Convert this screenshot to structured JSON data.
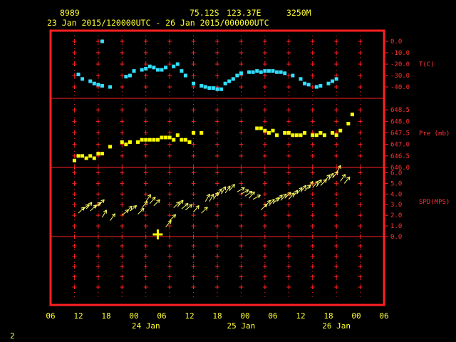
{
  "header": {
    "station_id": "8989",
    "latitude": "75.12S",
    "longitude": "123.37E",
    "elevation": "3250M",
    "time_range": "23 Jan 2015/120000UTC - 26 Jan 2015/000000UTC"
  },
  "footer_label": "2",
  "colors": {
    "frame": "#ff2020",
    "text": "#ffff33",
    "temp": "#33e0ff",
    "pres": "#ffff00",
    "wind": "#ffff66"
  },
  "x_axis": {
    "hour_labels": [
      "06",
      "12",
      "18",
      "00",
      "06",
      "12",
      "18",
      "00",
      "06",
      "12",
      "18",
      "00",
      "06"
    ],
    "date_labels": [
      "24 Jan",
      "25 Jan",
      "26 Jan"
    ],
    "date_label_hours": [
      30,
      54,
      78
    ]
  },
  "chart_data": [
    {
      "type": "scatter",
      "ylabel": "T(C)",
      "ylim": [
        -50,
        5
      ],
      "tick_labels": [
        "0.0",
        "-10.0",
        "-20.0",
        "-30.0",
        "-40.0"
      ],
      "x_hours": [
        13,
        14,
        16,
        17,
        18,
        19,
        21,
        25,
        26,
        27,
        29,
        30,
        31,
        32,
        33,
        34,
        35,
        37,
        38,
        39,
        40,
        42,
        44,
        45,
        46,
        47,
        48,
        49,
        50,
        51,
        52,
        53,
        54,
        56,
        57,
        58,
        59,
        60,
        61,
        62,
        63,
        64,
        65,
        67,
        69,
        70,
        71,
        73,
        74,
        76,
        77,
        78,
        19
      ],
      "values": [
        -29,
        -33,
        -35,
        -37,
        -38,
        -39,
        -40,
        -31,
        -30,
        -26,
        -25,
        -24,
        -22,
        -23,
        -25,
        -25,
        -23,
        -22,
        -20,
        -26,
        -30,
        -37,
        -39,
        -40,
        -41,
        -41,
        -42,
        -42,
        -37,
        -35,
        -33,
        -30,
        -28,
        -27,
        -27,
        -26,
        -27,
        -26,
        -26,
        -26,
        -27,
        -27,
        -28,
        -30,
        -33,
        -37,
        -38,
        -40,
        -39,
        -37,
        -35,
        -33,
        0
      ]
    },
    {
      "type": "scatter",
      "ylabel": "Pre (mb)",
      "ylim": [
        646,
        649
      ],
      "tick_labels": [
        "648.5",
        "648.0",
        "647.5",
        "647.0",
        "646.5",
        "646.0"
      ],
      "x_hours": [
        12,
        13,
        14,
        15,
        16,
        17,
        18,
        19,
        21,
        24,
        25,
        26,
        28,
        29,
        30,
        31,
        32,
        33,
        34,
        35,
        36,
        37,
        38,
        39,
        40,
        41,
        42,
        44,
        58,
        59,
        60,
        61,
        62,
        63,
        65,
        66,
        67,
        68,
        69,
        70,
        72,
        73,
        74,
        75,
        77,
        78,
        79,
        81,
        82
      ],
      "values": [
        646.3,
        646.5,
        646.5,
        646.4,
        646.5,
        646.4,
        646.6,
        646.6,
        646.9,
        647.1,
        647.0,
        647.1,
        647.1,
        647.2,
        647.2,
        647.2,
        647.2,
        647.2,
        647.3,
        647.3,
        647.3,
        647.2,
        647.4,
        647.2,
        647.2,
        647.1,
        647.5,
        647.5,
        647.7,
        647.7,
        647.6,
        647.5,
        647.6,
        647.4,
        647.5,
        647.5,
        647.4,
        647.4,
        647.4,
        647.5,
        647.4,
        647.4,
        647.5,
        647.4,
        647.5,
        647.4,
        647.6,
        647.9,
        648.3
      ]
    },
    {
      "type": "scatter",
      "ylabel": "SPD(MPS)",
      "ylim": [
        0,
        6.5
      ],
      "tick_labels": [
        "6.0",
        "5.0",
        "4.0",
        "3.0",
        "2.0",
        "1.0",
        "0.0"
      ],
      "x_hours": [
        13,
        14,
        15,
        16,
        17,
        18,
        19,
        21,
        24,
        25,
        26,
        28,
        29,
        30,
        31,
        32,
        33,
        35,
        36,
        37,
        38,
        39,
        40,
        42,
        44,
        45,
        46,
        47,
        48,
        49,
        50,
        51,
        53,
        54,
        55,
        56,
        57,
        59,
        60,
        61,
        62,
        63,
        64,
        65,
        66,
        67,
        68,
        69,
        70,
        71,
        72,
        73,
        74,
        75,
        76,
        77,
        78,
        79,
        80
      ],
      "values": [
        2.2,
        2.5,
        2.6,
        2.4,
        2.7,
        2.9,
        1.8,
        1.5,
        2.0,
        2.3,
        2.4,
        2.1,
        2.7,
        3.3,
        3.1,
        2.9,
        0.2,
        0.9,
        1.5,
        2.7,
        2.8,
        2.6,
        2.5,
        2.3,
        2.2,
        3.3,
        3.3,
        3.5,
        3.8,
        4.0,
        4.1,
        4.3,
        4.2,
        4.0,
        3.8,
        3.6,
        3.5,
        2.5,
        2.8,
        2.9,
        3.1,
        3.3,
        3.4,
        3.6,
        3.5,
        3.7,
        4.0,
        4.2,
        4.3,
        4.5,
        4.6,
        4.7,
        4.8,
        5.2,
        5.3,
        5.5,
        6.0,
        5.2,
        5.0
      ],
      "directions_deg": [
        45,
        50,
        40,
        45,
        50,
        45,
        30,
        35,
        50,
        45,
        50,
        45,
        40,
        35,
        40,
        45,
        200,
        40,
        45,
        45,
        40,
        50,
        50,
        40,
        45,
        30,
        30,
        35,
        30,
        30,
        35,
        40,
        60,
        60,
        55,
        40,
        60,
        45,
        40,
        40,
        45,
        40,
        40,
        45,
        40,
        35,
        40,
        40,
        45,
        30,
        40,
        35,
        45,
        40,
        35,
        40,
        30,
        35,
        40
      ]
    }
  ]
}
